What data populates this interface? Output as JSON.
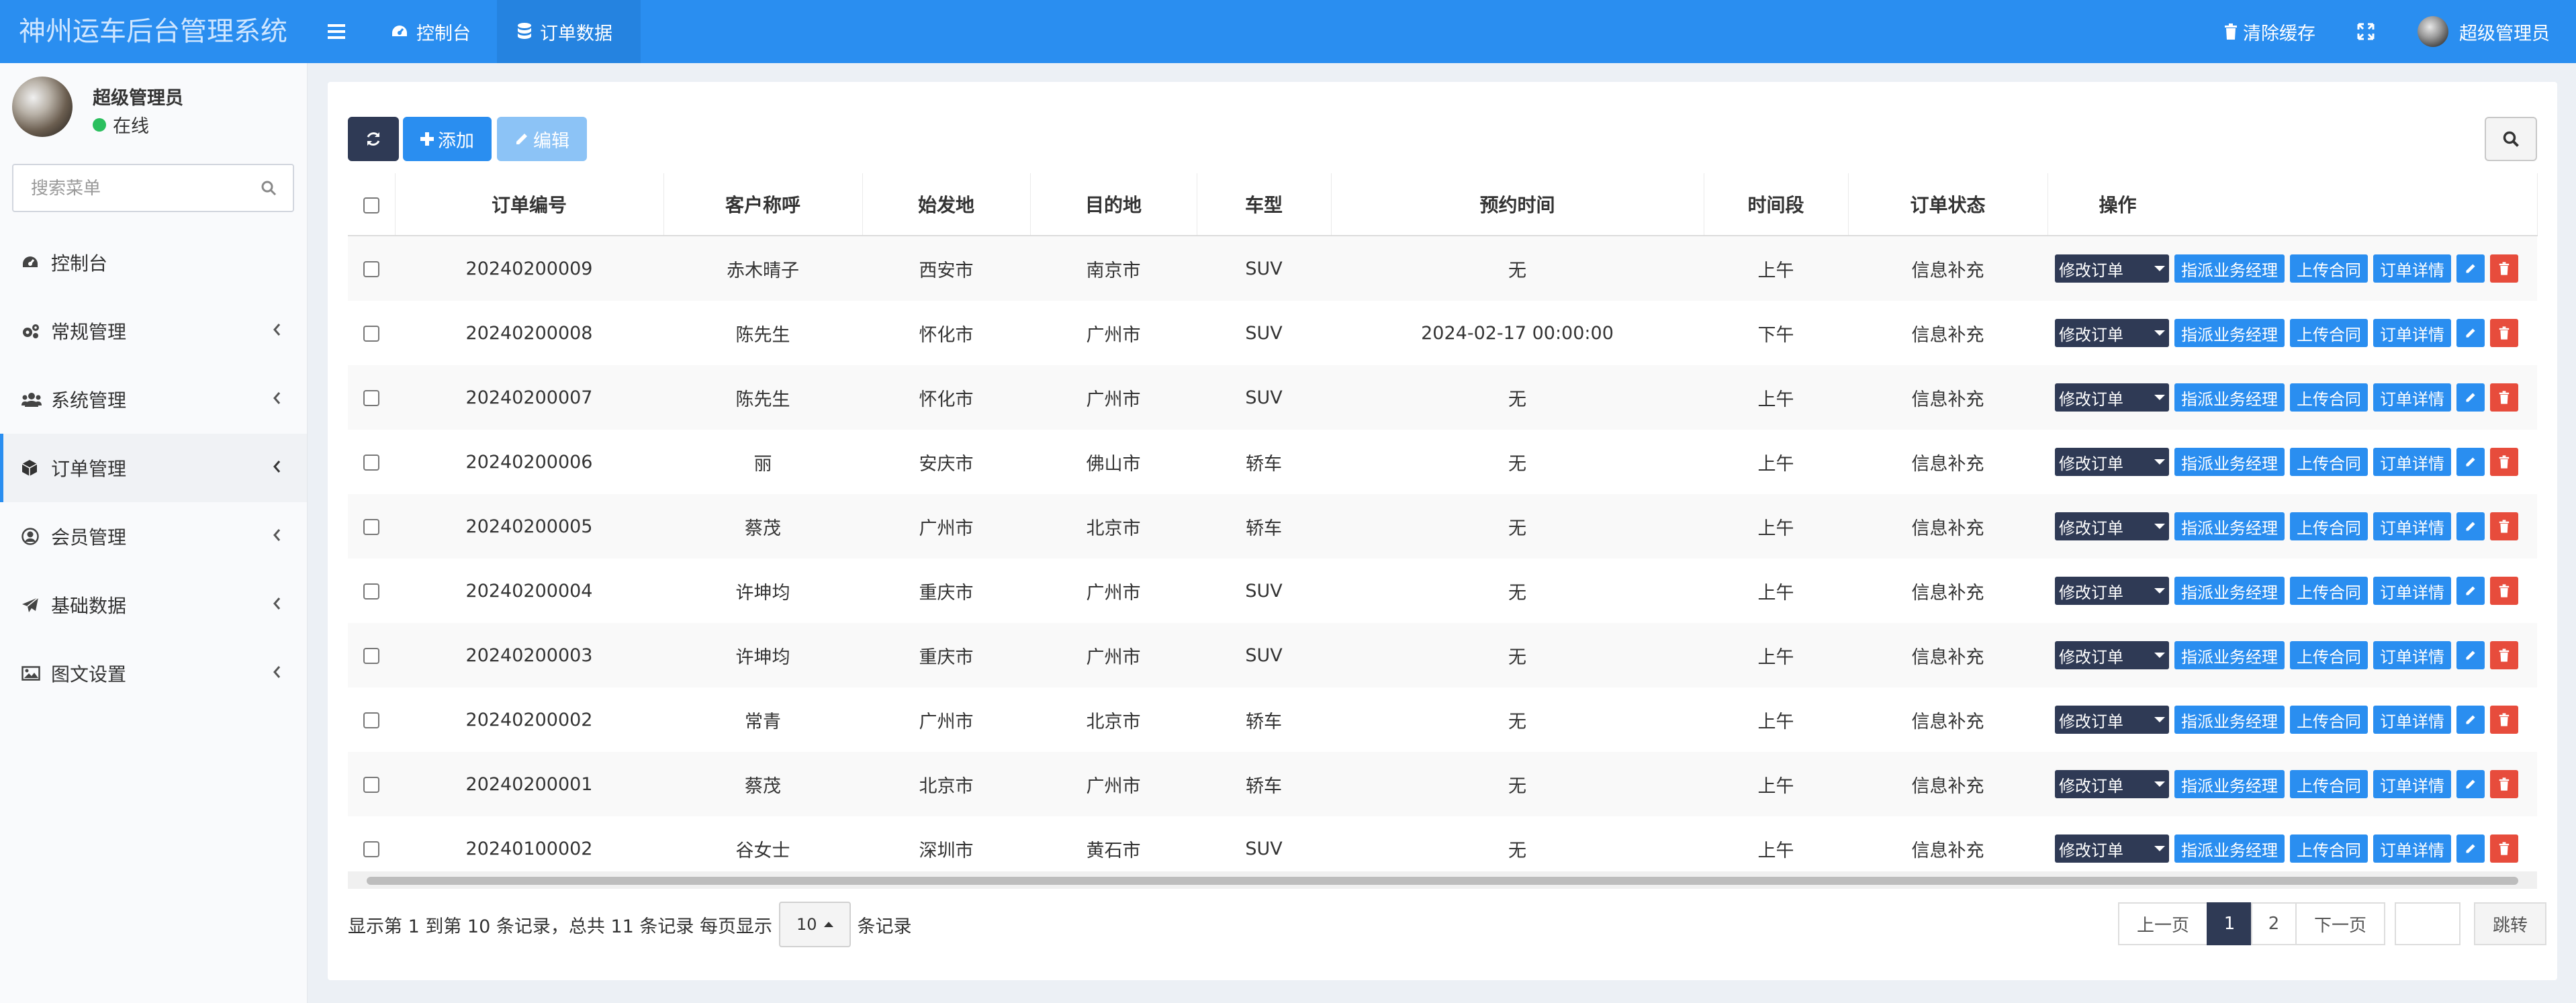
{
  "app": {
    "title": "神州运车后台管理系统"
  },
  "topnav": {
    "tabs": [
      {
        "label": "控制台",
        "icon": "dashboard-icon"
      },
      {
        "label": "订单数据",
        "icon": "database-icon",
        "active": true
      }
    ],
    "clear_cache": "清除缓存",
    "user": "超级管理员"
  },
  "sidebar": {
    "user_name": "超级管理员",
    "status": "在线",
    "search_placeholder": "搜索菜单",
    "items": [
      {
        "label": "控制台",
        "icon": "dashboard-icon",
        "has_children": false
      },
      {
        "label": "常规管理",
        "icon": "gears-icon",
        "has_children": true
      },
      {
        "label": "系统管理",
        "icon": "users-icon",
        "has_children": true
      },
      {
        "label": "订单管理",
        "icon": "cube-icon",
        "has_children": true,
        "active": true
      },
      {
        "label": "会员管理",
        "icon": "user-circle-icon",
        "has_children": true
      },
      {
        "label": "基础数据",
        "icon": "paper-plane-icon",
        "has_children": true
      },
      {
        "label": "图文设置",
        "icon": "image-icon",
        "has_children": true
      }
    ]
  },
  "toolbar": {
    "add": "添加",
    "edit": "编辑"
  },
  "table": {
    "columns": [
      "订单编号",
      "客户称呼",
      "始发地",
      "目的地",
      "车型",
      "预约时间",
      "时间段",
      "订单状态",
      "操作"
    ],
    "rows": [
      [
        "20240200009",
        "赤木晴子",
        "西安市",
        "南京市",
        "SUV",
        "无",
        "上午",
        "信息补充"
      ],
      [
        "20240200008",
        "陈先生",
        "怀化市",
        "广州市",
        "SUV",
        "2024-02-17 00:00:00",
        "下午",
        "信息补充"
      ],
      [
        "20240200007",
        "陈先生",
        "怀化市",
        "广州市",
        "SUV",
        "无",
        "上午",
        "信息补充"
      ],
      [
        "20240200006",
        "丽",
        "安庆市",
        "佛山市",
        "轿车",
        "无",
        "上午",
        "信息补充"
      ],
      [
        "20240200005",
        "蔡茂",
        "广州市",
        "北京市",
        "轿车",
        "无",
        "上午",
        "信息补充"
      ],
      [
        "20240200004",
        "许坤均",
        "重庆市",
        "广州市",
        "SUV",
        "无",
        "上午",
        "信息补充"
      ],
      [
        "20240200003",
        "许坤均",
        "重庆市",
        "广州市",
        "SUV",
        "无",
        "上午",
        "信息补充"
      ],
      [
        "20240200002",
        "常青",
        "广州市",
        "北京市",
        "轿车",
        "无",
        "上午",
        "信息补充"
      ],
      [
        "20240200001",
        "蔡茂",
        "北京市",
        "广州市",
        "轿车",
        "无",
        "上午",
        "信息补充"
      ],
      [
        "20240100002",
        "谷女士",
        "深圳市",
        "黄石市",
        "SUV",
        "无",
        "上午",
        "信息补充"
      ]
    ],
    "row_actions": {
      "modify": "修改订单",
      "assign": "指派业务经理",
      "upload": "上传合同",
      "detail": "订单详情"
    }
  },
  "footer": {
    "info_prefix": "显示第 1 到第 10 条记录，总共 11 条记录 每页显示",
    "page_size": "10",
    "info_suffix": "条记录",
    "prev": "上一页",
    "pages": [
      "1",
      "2"
    ],
    "next": "下一页",
    "jump": "跳转"
  },
  "colors": {
    "primary": "#2a8ef0",
    "dark": "#2f3a55",
    "danger": "#e74c3c",
    "online": "#2bbf5e"
  }
}
